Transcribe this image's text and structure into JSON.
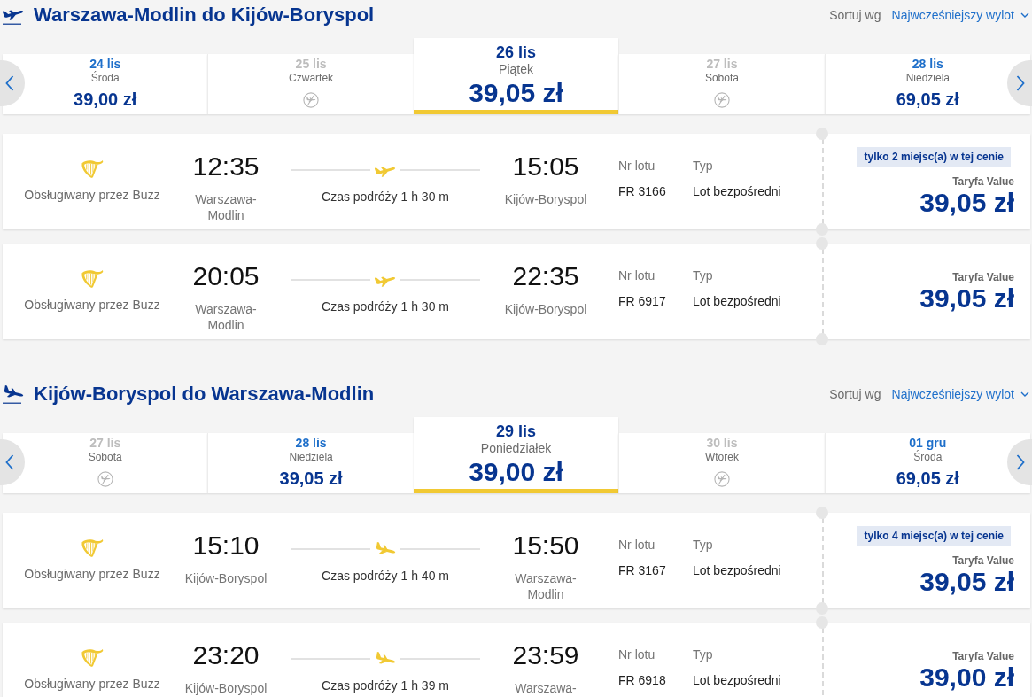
{
  "sections": [
    {
      "kind": "outbound",
      "title": "Warszawa-Modlin do Kijów-Boryspol",
      "sort": {
        "label": "Sortuj wg",
        "value": "Najwcześniejszy wylot"
      },
      "dates": [
        {
          "date": "24 lis",
          "weekday": "Środa",
          "price": "39,00 zł",
          "available": true,
          "selected": false
        },
        {
          "date": "25 lis",
          "weekday": "Czwartek",
          "available": false,
          "selected": false
        },
        {
          "date": "26 lis",
          "weekday": "Piątek",
          "price": "39,05 zł",
          "available": true,
          "selected": true
        },
        {
          "date": "27 lis",
          "weekday": "Sobota",
          "available": false,
          "selected": false
        },
        {
          "date": "28 lis",
          "weekday": "Niedziela",
          "price": "69,05 zł",
          "available": true,
          "selected": false
        }
      ],
      "flights": [
        {
          "operator": "Obsługiwany przez Buzz",
          "departure_time": "12:35",
          "departure_airport": "Warszawa-Modlin",
          "duration": "Czas podróży 1 h 30 m",
          "arrival_time": "15:05",
          "arrival_airport": "Kijów-Boryspol",
          "flight_no_label": "Nr lotu",
          "flight_no": "FR 3166",
          "type_label": "Typ",
          "type": "Lot bezpośredni",
          "seats_badge": "tylko 2 miejsc(a) w tej cenie",
          "fare": "Taryfa Value",
          "price": "39,05 zł"
        },
        {
          "operator": "Obsługiwany przez Buzz",
          "departure_time": "20:05",
          "departure_airport": "Warszawa-Modlin",
          "duration": "Czas podróży 1 h 30 m",
          "arrival_time": "22:35",
          "arrival_airport": "Kijów-Boryspol",
          "flight_no_label": "Nr lotu",
          "flight_no": "FR 6917",
          "type_label": "Typ",
          "type": "Lot bezpośredni",
          "fare": "Taryfa Value",
          "price": "39,05 zł"
        }
      ]
    },
    {
      "kind": "return",
      "title": "Kijów-Boryspol do Warszawa-Modlin",
      "sort": {
        "label": "Sortuj wg",
        "value": "Najwcześniejszy wylot"
      },
      "dates": [
        {
          "date": "27 lis",
          "weekday": "Sobota",
          "available": false,
          "selected": false
        },
        {
          "date": "28 lis",
          "weekday": "Niedziela",
          "price": "39,05 zł",
          "available": true,
          "selected": false
        },
        {
          "date": "29 lis",
          "weekday": "Poniedziałek",
          "price": "39,00 zł",
          "available": true,
          "selected": true
        },
        {
          "date": "30 lis",
          "weekday": "Wtorek",
          "available": false,
          "selected": false
        },
        {
          "date": "01 gru",
          "weekday": "Środa",
          "price": "69,05 zł",
          "available": true,
          "selected": false
        }
      ],
      "flights": [
        {
          "operator": "Obsługiwany przez Buzz",
          "departure_time": "15:10",
          "departure_airport": "Kijów-Boryspol",
          "duration": "Czas podróży 1 h 40 m",
          "arrival_time": "15:50",
          "arrival_airport": "Warszawa-Modlin",
          "flight_no_label": "Nr lotu",
          "flight_no": "FR 3167",
          "type_label": "Typ",
          "type": "Lot bezpośredni",
          "seats_badge": "tylko 4 miejsc(a) w tej cenie",
          "fare": "Taryfa Value",
          "price": "39,05 zł"
        },
        {
          "operator": "Obsługiwany przez Buzz",
          "departure_time": "23:20",
          "departure_airport": "Kijów-Boryspol",
          "duration": "Czas podróży 1 h 39 m",
          "arrival_time": "23:59",
          "arrival_airport": "Warszawa-",
          "flight_no_label": "Nr lotu",
          "flight_no": "FR 6918",
          "type_label": "Typ",
          "type": "Lot bezpośredni",
          "fare": "Taryfa Value",
          "price": "39,00 zł"
        }
      ]
    }
  ]
}
